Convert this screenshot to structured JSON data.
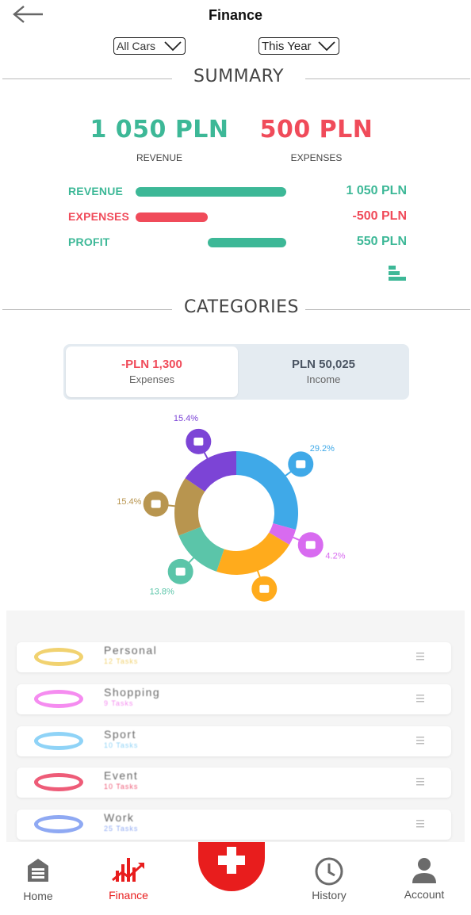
{
  "header": {
    "title": "Finance",
    "car_filter": "All Cars",
    "period_filter": "This Year"
  },
  "summary": {
    "heading": "SUMMARY",
    "revenue_total": "1 050 PLN",
    "revenue_caption": "REVENUE",
    "expenses_total": "500 PLN",
    "expenses_caption": "EXPENSES",
    "rows": [
      {
        "label": "REVENUE",
        "value": "1 050 PLN",
        "bar_fraction": 1.0,
        "color": "#3db897"
      },
      {
        "label": "EXPENSES",
        "value": "-500 PLN",
        "bar_fraction": 0.48,
        "color": "#f04b5a"
      },
      {
        "label": "PROFIT",
        "value": "550 PLN",
        "bar_fraction": 0.52,
        "color": "#3db897"
      }
    ],
    "chart_toggle_icon": "bar-chart-icon"
  },
  "categories": {
    "heading": "CATEGORIES",
    "tabs": [
      {
        "amount": "-PLN 1,300",
        "label": "Expenses",
        "selected": true,
        "color": "#f04b5a"
      },
      {
        "amount": "PLN 50,025",
        "label": "Income",
        "selected": false,
        "color": "#4b5563"
      }
    ],
    "donut": [
      {
        "category": "car",
        "percent": "29.2%",
        "value": 29.2,
        "color": "#3fa9e8",
        "icon": "car-icon"
      },
      {
        "category": "shopping",
        "percent": "4.2%",
        "value": 4.2,
        "color": "#d86bf0",
        "icon": "shopping-bag-icon"
      },
      {
        "category": "food",
        "percent": "21.5%",
        "value": 21.5,
        "color": "#ffab1c",
        "icon": "fork-knife-icon"
      },
      {
        "category": "money",
        "percent": "13.8%",
        "value": 13.8,
        "color": "#5bc5a9",
        "icon": "money-icon"
      },
      {
        "category": "home",
        "percent": "15.4%",
        "value": 15.4,
        "color": "#b8954f",
        "icon": "home-icon"
      },
      {
        "category": "flower",
        "percent": "15.4%",
        "value": 15.4,
        "color": "#7c44d6",
        "icon": "flower-icon"
      }
    ]
  },
  "list": {
    "items": [
      {
        "name": "Personal",
        "tasks": "12 Tasks",
        "color": "#f1d270"
      },
      {
        "name": "Shopping",
        "tasks": "9 Tasks",
        "color": "#f58cf0"
      },
      {
        "name": "Sport",
        "tasks": "10 Tasks",
        "color": "#8fd3f7"
      },
      {
        "name": "Event",
        "tasks": "10 Tasks",
        "color": "#ee5c78"
      },
      {
        "name": "Work",
        "tasks": "25 Tasks",
        "color": "#8fa9f3"
      }
    ]
  },
  "nav": {
    "items": [
      {
        "label": "Home",
        "icon": "garage-icon",
        "active": false
      },
      {
        "label": "Finance",
        "icon": "finance-chart-icon",
        "active": true
      },
      {
        "label": "History",
        "icon": "clock-icon",
        "active": false
      },
      {
        "label": "Account",
        "icon": "person-icon",
        "active": false
      }
    ],
    "fab_icon": "plus-icon",
    "active_color": "#e81d1d",
    "inactive_color": "#6b6b6b"
  }
}
